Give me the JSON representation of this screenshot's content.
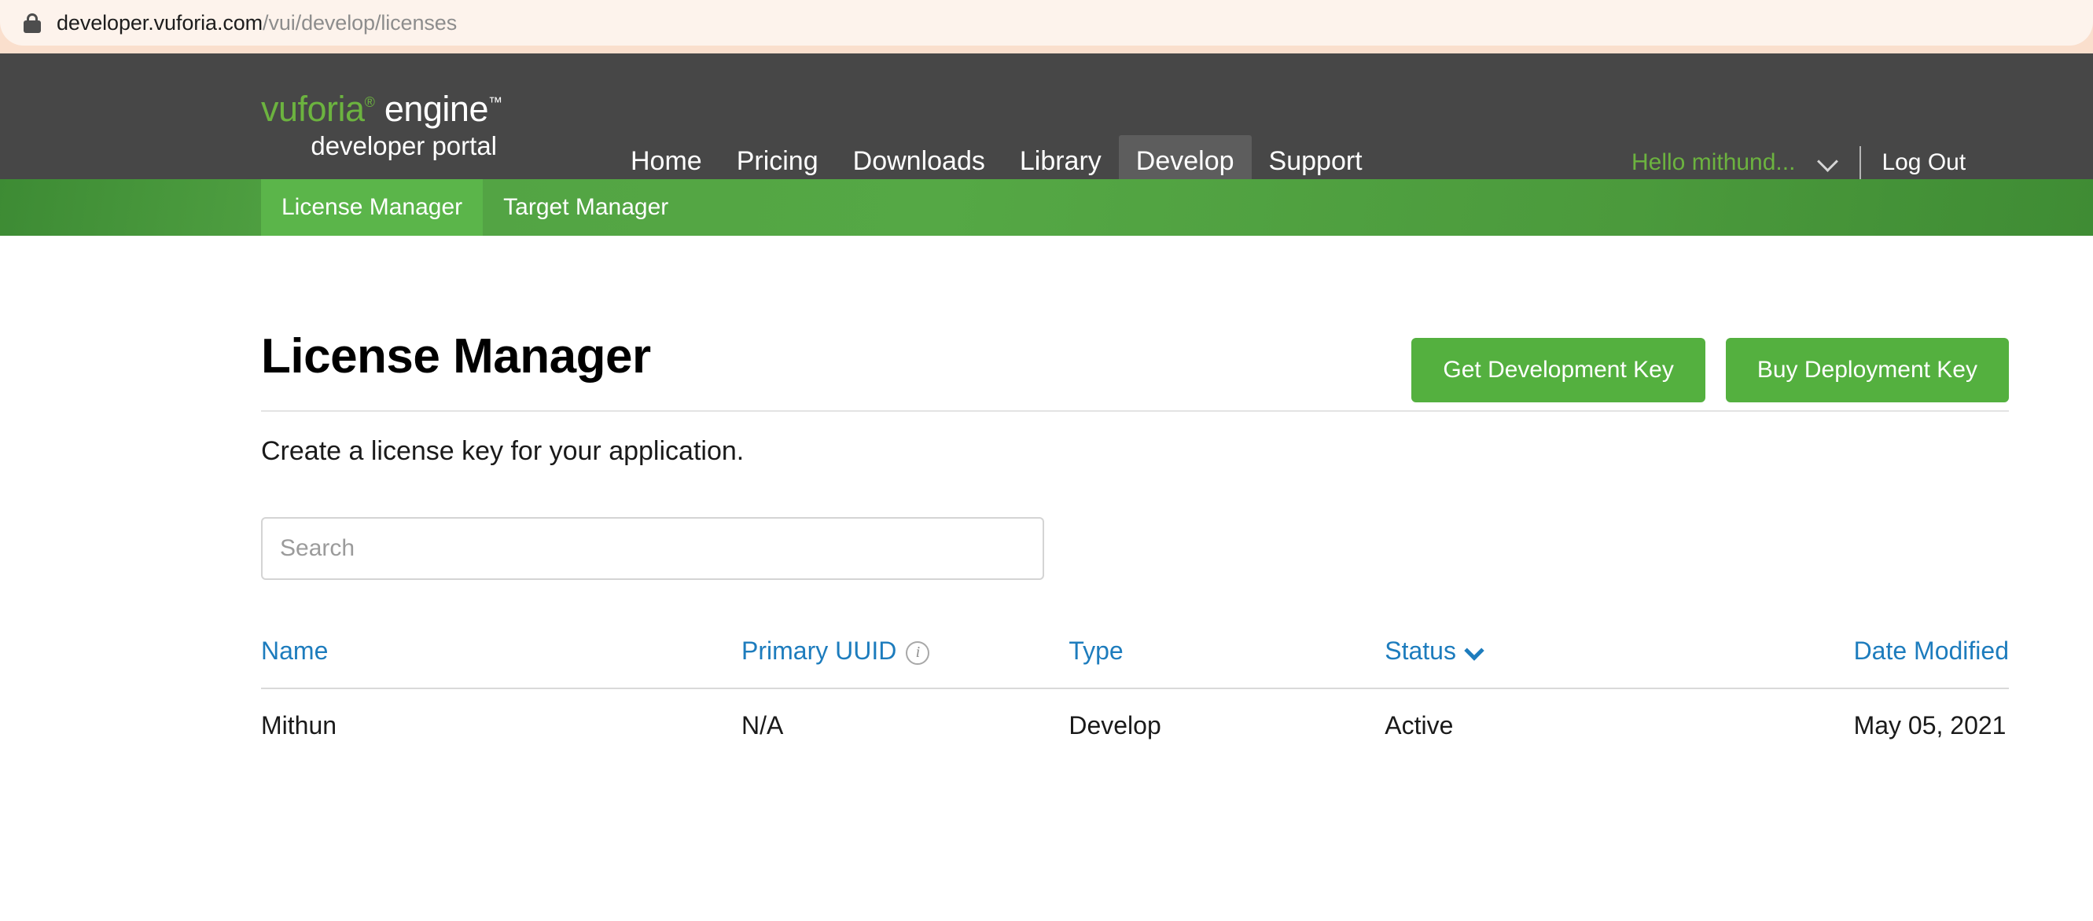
{
  "browser": {
    "lock_icon": "lock-icon",
    "url_domain": "developer.vuforia.com",
    "url_path": "/vui/develop/licenses"
  },
  "header": {
    "logo": {
      "brand": "vuforia",
      "registered_mark": "®",
      "product": " engine",
      "trademark": "™",
      "tagline": "developer portal"
    },
    "nav_items": [
      {
        "label": "Home",
        "active": false
      },
      {
        "label": "Pricing",
        "active": false
      },
      {
        "label": "Downloads",
        "active": false
      },
      {
        "label": "Library",
        "active": false
      },
      {
        "label": "Develop",
        "active": true
      },
      {
        "label": "Support",
        "active": false
      }
    ],
    "user": {
      "greeting": "Hello mithund...",
      "chevron_icon": "chevron-down-icon",
      "logout_label": "Log Out"
    }
  },
  "subnav": {
    "tabs": [
      {
        "label": "License Manager",
        "active": true
      },
      {
        "label": "Target Manager",
        "active": false
      }
    ]
  },
  "main": {
    "page_title": "License Manager",
    "actions": [
      {
        "label": "Get Development Key",
        "name": "get-development-key-button"
      },
      {
        "label": "Buy Deployment Key",
        "name": "buy-deployment-key-button"
      }
    ],
    "subtitle": "Create a license key for your application.",
    "search": {
      "placeholder": "Search",
      "value": ""
    },
    "table": {
      "columns": [
        {
          "label": "Name",
          "info_icon": false,
          "sort_icon": false
        },
        {
          "label": "Primary UUID",
          "info_icon": true,
          "sort_icon": false
        },
        {
          "label": "Type",
          "info_icon": false,
          "sort_icon": false
        },
        {
          "label": "Status",
          "info_icon": false,
          "sort_icon": true
        },
        {
          "label": "Date Modified",
          "info_icon": false,
          "sort_icon": false
        }
      ],
      "rows": [
        {
          "name": "Mithun",
          "primary_uuid": "N/A",
          "type": "Develop",
          "status": "Active",
          "date_modified": "May 05, 2021"
        }
      ]
    }
  },
  "colors": {
    "brand_green": "#6cb33f",
    "button_green": "#54b03f",
    "subnav_green": "#4b9a3c",
    "header_gray": "#474747",
    "link_blue": "#1d7cbd",
    "urlbar_peach": "#fdf3ec"
  }
}
